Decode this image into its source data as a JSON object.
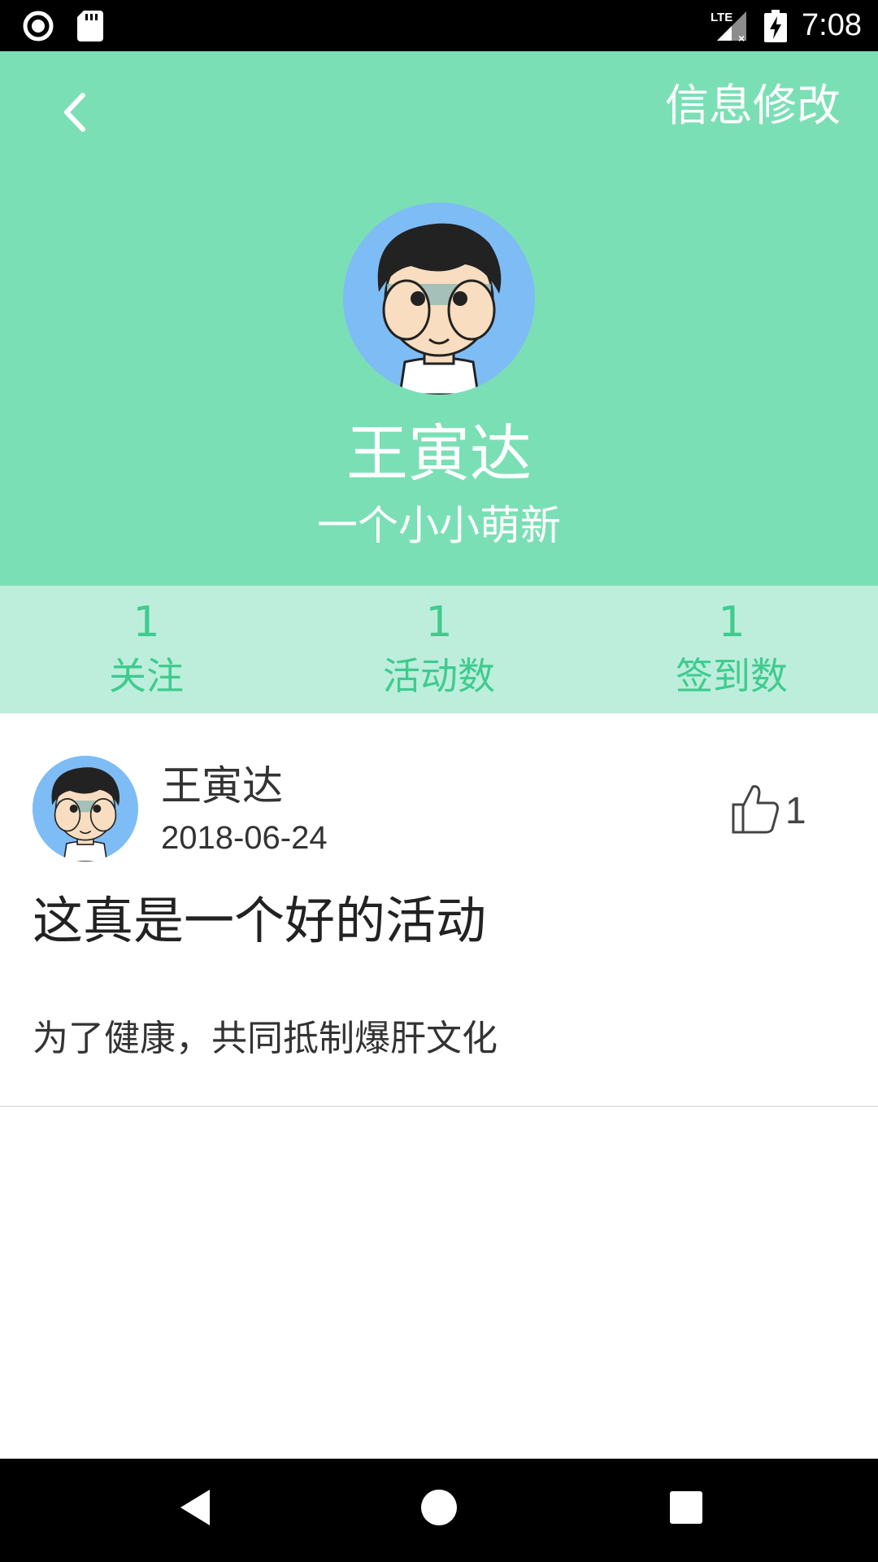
{
  "status_bar": {
    "time": "7:08",
    "icons": [
      "record-icon",
      "sd-card-icon",
      "lte-signal-icon",
      "battery-charging-icon"
    ]
  },
  "header": {
    "back_icon": "chevron-left-icon",
    "edit_label": "信息修改",
    "user_name": "王寅达",
    "user_motto": "一个小小萌新",
    "background_color": "#7BDFB5"
  },
  "stats": [
    {
      "value": "1",
      "label": "关注"
    },
    {
      "value": "1",
      "label": "活动数"
    },
    {
      "value": "1",
      "label": "签到数"
    }
  ],
  "stats_colors": {
    "background": "#BDEEDB",
    "text": "#3FCB8F"
  },
  "post": {
    "author": "王寅达",
    "date": "2018-06-24",
    "like_count": "1",
    "title": "这真是一个好的活动",
    "content": "为了健康，共同抵制爆肝文化"
  },
  "nav_bar": {
    "icons": [
      "back-triangle-icon",
      "home-circle-icon",
      "recents-square-icon"
    ]
  }
}
